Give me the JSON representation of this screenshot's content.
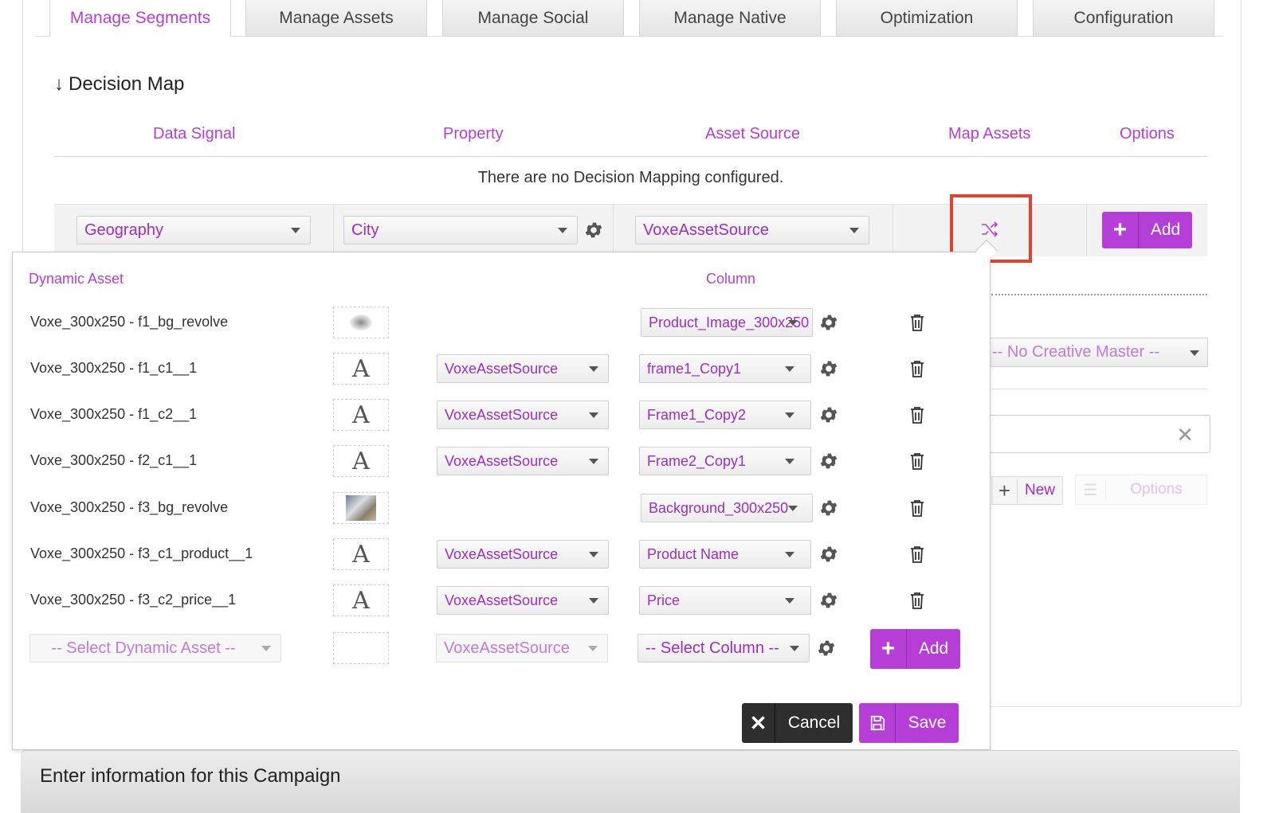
{
  "tabs": [
    {
      "label": "Manage Segments",
      "active": true
    },
    {
      "label": "Manage Assets",
      "active": false
    },
    {
      "label": "Manage Social",
      "active": false
    },
    {
      "label": "Manage Native",
      "active": false
    },
    {
      "label": "Optimization",
      "active": false
    },
    {
      "label": "Configuration",
      "active": false
    }
  ],
  "decision_map": {
    "title": "Decision Map",
    "columns": [
      "Data Signal",
      "Property",
      "Asset Source",
      "Map Assets",
      "Options"
    ],
    "empty_message": "There are no Decision Mapping configured.",
    "row": {
      "data_signal": "Geography",
      "property": "City",
      "asset_source": "VoxeAssetSource",
      "add_label": "Add"
    }
  },
  "background": {
    "creative_master": "-- No Creative Master --",
    "new_label": "New",
    "options_label": "Options"
  },
  "popup": {
    "headers": {
      "dynamic_asset": "Dynamic Asset",
      "column": "Column"
    },
    "rows": [
      {
        "name": "Voxe_300x250 - f1_bg_revolve",
        "thumb": "image-small",
        "source": "",
        "column": "Product_Image_300x250"
      },
      {
        "name": "Voxe_300x250 - f1_c1__1",
        "thumb": "text",
        "source": "VoxeAssetSource",
        "column": "frame1_Copy1"
      },
      {
        "name": "Voxe_300x250 - f1_c2__1",
        "thumb": "text",
        "source": "VoxeAssetSource",
        "column": "Frame1_Copy2"
      },
      {
        "name": "Voxe_300x250 - f2_c1__1",
        "thumb": "text",
        "source": "VoxeAssetSource",
        "column": "Frame2_Copy1"
      },
      {
        "name": "Voxe_300x250 - f3_bg_revolve",
        "thumb": "image-photo",
        "source": "",
        "column": "Background_300x250"
      },
      {
        "name": "Voxe_300x250 - f3_c1_product__1",
        "thumb": "text",
        "source": "VoxeAssetSource",
        "column": "Product Name"
      },
      {
        "name": "Voxe_300x250 - f3_c2_price__1",
        "thumb": "text",
        "source": "VoxeAssetSource",
        "column": "Price"
      }
    ],
    "text_glyph": "A",
    "new_row": {
      "asset_placeholder": "-- Select Dynamic Asset --",
      "source": "VoxeAssetSource",
      "column_placeholder": "-- Select Column --",
      "add_label": "Add"
    },
    "cancel_label": "Cancel",
    "save_label": "Save"
  },
  "footer": {
    "title": "Enter information for this Campaign"
  },
  "colors": {
    "accent": "#b43ed6",
    "highlight": "#e8402e",
    "dark_button": "#2e2e2e"
  }
}
